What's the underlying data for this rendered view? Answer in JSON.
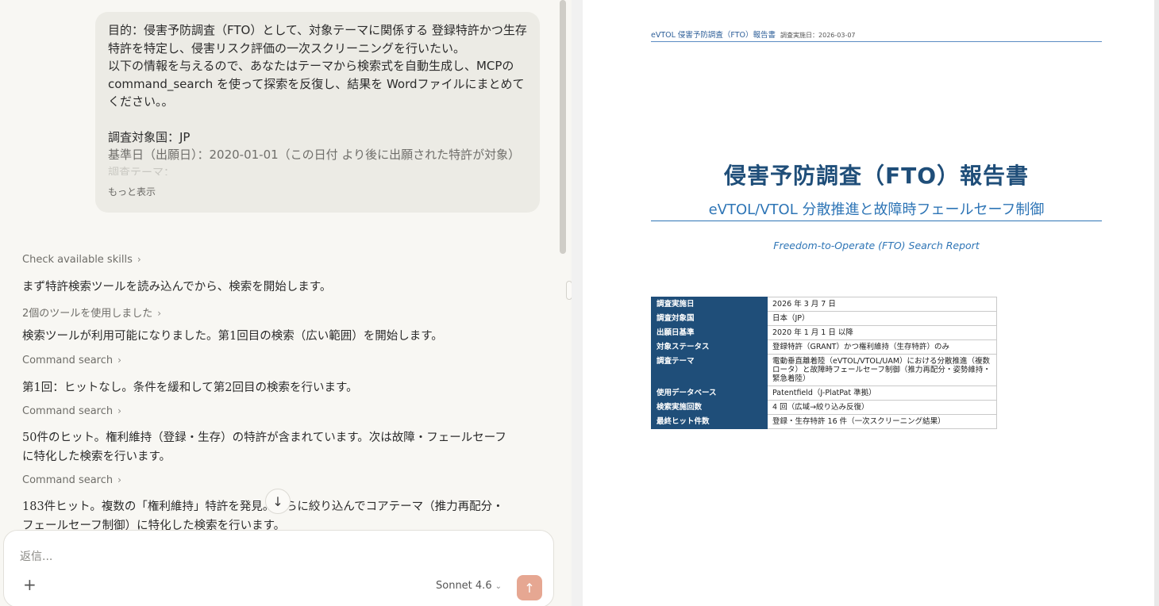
{
  "chat": {
    "user_message": {
      "lines": [
        "目的：侵害予防調査（FTO）として、対象テーマに関係する 登録特許かつ生存特許を特定し、侵害リスク評価の一次スクリーニングを行いたい。",
        "以下の情報を与えるので、あなたはテーマから検索式を自動生成し、MCPの command_search を使って探索を反復し、結果を Wordファイルにまとめてください。。"
      ],
      "country": "調査対象国：JP",
      "base_date": "基準日（出願日）：2020-01-01（この日付 より後に出願された特許が対象）",
      "theme_cut": "調査テーマ：",
      "show_more": "もっと表示"
    },
    "steps": [
      {
        "type": "label",
        "text": "Check available skills"
      },
      {
        "type": "text",
        "text": "まず特許検索ツールを読み込んでから、検索を開始します。"
      },
      {
        "type": "label",
        "text": "2個のツールを使用しました"
      },
      {
        "type": "text",
        "text": "検索ツールが利用可能になりました。第1回目の検索（広い範囲）を開始します。"
      },
      {
        "type": "label",
        "text": "Command search"
      },
      {
        "type": "text",
        "text": "第1回：ヒットなし。条件を緩和して第2回目の検索を行います。"
      },
      {
        "type": "label",
        "text": "Command search"
      },
      {
        "type": "text",
        "text": "50件のヒット。権利維持（登録・生存）の特許が含まれています。次は故障・フェールセーフに特化した検索を行います。"
      },
      {
        "type": "label",
        "text": "Command search"
      },
      {
        "type": "text",
        "text": "183件ヒット。複数の「権利維持」特許を発見。さらに絞り込んでコアテーマ（推力再配分・フェールセーフ制御）に特化した検索を行います。"
      }
    ],
    "composer": {
      "placeholder": "返信...",
      "model": "Sonnet 4.6"
    }
  },
  "document": {
    "header": "eVTOL 侵害予防調査（FTO）報告書",
    "header_date": "調査実施日：2026-03-07",
    "title": "侵害予防調査（FTO）報告書",
    "subtitle": "eVTOL/VTOL 分散推進と故障時フェールセーフ制御",
    "english_title": "Freedom-to-Operate (FTO) Search Report",
    "table": [
      {
        "key": "調査実施日",
        "value": "2026 年 3 月 7 日"
      },
      {
        "key": "調査対象国",
        "value": "日本（JP）"
      },
      {
        "key": "出願日基準",
        "value": "2020 年 1 月 1 日 以降"
      },
      {
        "key": "対象ステータス",
        "value": "登録特許（GRANT）かつ権利維持（生存特許）のみ"
      },
      {
        "key": "調査テーマ",
        "value": "電動垂直離着陸（eVTOL/VTOL/UAM）における分散推進（複数ロータ）と故障時フェールセーフ制御（推力再配分・姿勢維持・緊急着陸）"
      },
      {
        "key": "使用データベース",
        "value": "Patentfield（J-PlatPat 準拠）"
      },
      {
        "key": "検索実施回数",
        "value": "4 回（広域→絞り込み反復）"
      },
      {
        "key": "最終ヒット件数",
        "value": "登録・生存特許 16 件（一次スクリーニング結果）"
      }
    ]
  },
  "icons": {
    "chevron": "chevron-right-icon",
    "down": "arrow-down-icon",
    "plus": "plus-icon",
    "send": "arrow-up-icon"
  },
  "colors": {
    "send_button": "#e6a792",
    "doc_accent": "#1f4e79",
    "doc_blue": "#2e75b6"
  }
}
